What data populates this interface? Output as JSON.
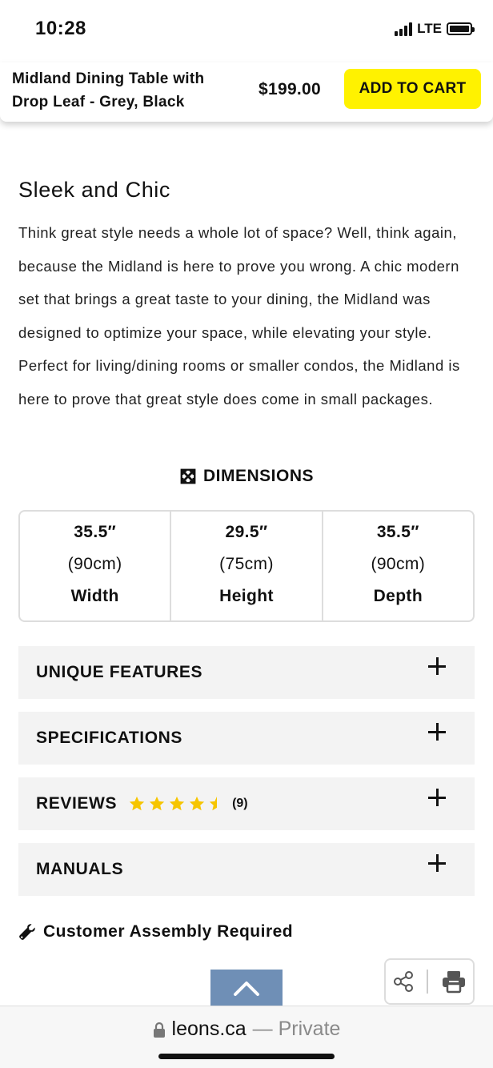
{
  "status_bar": {
    "time": "10:28",
    "network": "LTE"
  },
  "product_bar": {
    "title": "Midland Dining Table with Drop Leaf - Grey, Black",
    "price": "$199.00",
    "add_to_cart_label": "ADD TO CART",
    "button_color": "#fff200"
  },
  "description": {
    "heading": "Sleek and Chic",
    "body": "Think great style needs a whole lot of space? Well, think again, because the Midland is here to prove you wrong. A chic modern set that brings a great taste to your dining, the Midland was designed to optimize your space, while elevating your style. Perfect for living/dining rooms or smaller condos, the Midland is here to prove that great style does come in small packages."
  },
  "dimensions": {
    "heading": "DIMENSIONS",
    "icon": "expand-arrows-icon",
    "items": [
      {
        "inches": "35.5″",
        "cm": "(90cm)",
        "label": "Width"
      },
      {
        "inches": "29.5″",
        "cm": "(75cm)",
        "label": "Height"
      },
      {
        "inches": "35.5″",
        "cm": "(90cm)",
        "label": "Depth"
      }
    ]
  },
  "accordions": [
    {
      "title": "UNIQUE FEATURES"
    },
    {
      "title": "SPECIFICATIONS"
    },
    {
      "title": "REVIEWS",
      "rating": 4.5,
      "rating_max": 5,
      "review_count": "(9)",
      "star_color": "#f6c500"
    },
    {
      "title": "MANUALS"
    }
  ],
  "assembly": {
    "label": "Customer Assembly Required",
    "icon": "wrench-icon"
  },
  "browser": {
    "host": "leons.ca",
    "suffix": "— Private"
  }
}
